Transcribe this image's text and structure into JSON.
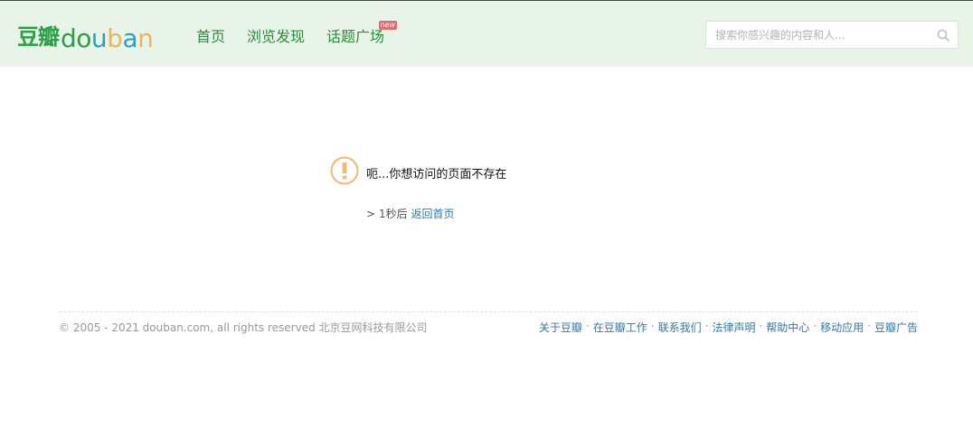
{
  "header": {
    "logo_cn": "豆瓣",
    "logo_en": "douban",
    "nav": [
      {
        "label": "首页"
      },
      {
        "label": "浏览发现"
      },
      {
        "label": "话题广场",
        "badge": "new"
      }
    ],
    "search": {
      "placeholder": "搜索你感兴趣的内容和人...",
      "value": ""
    }
  },
  "error": {
    "message": "呃...你想访问的页面不存在",
    "countdown_prefix": "> 1秒后",
    "return_link": "返回首页"
  },
  "footer": {
    "copyright": "© 2005 - 2021 douban.com, all rights reserved 北京豆网科技有限公司",
    "links": [
      "关于豆瓣",
      "在豆瓣工作",
      "联系我们",
      "法律声明",
      "帮助中心",
      "移动应用",
      "豆瓣广告"
    ],
    "separator": "·"
  },
  "colors": {
    "header_bg": "#e9f4e9",
    "brand_green": "#2c9e47",
    "link_blue": "#3377aa",
    "warning_orange": "#f3b978"
  }
}
